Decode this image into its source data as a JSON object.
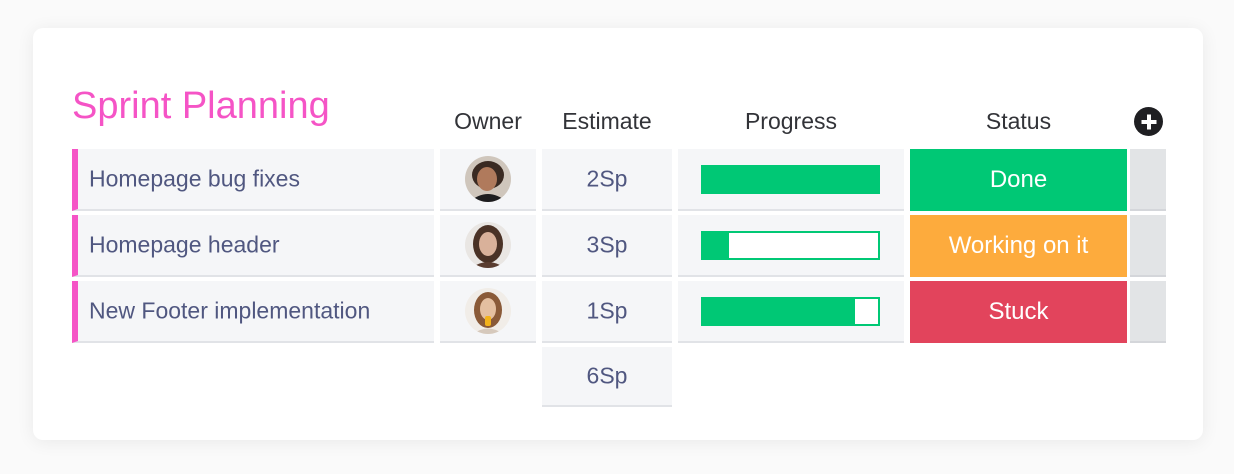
{
  "board": {
    "title": "Sprint Planning",
    "columns": {
      "owner": "Owner",
      "estimate": "Estimate",
      "progress": "Progress",
      "status": "Status"
    }
  },
  "colors": {
    "accent": "#f554c6",
    "done": "#00c875",
    "working": "#fdab3d",
    "stuck": "#e2445c"
  },
  "rows": [
    {
      "name": "Homepage bug fixes",
      "owner_avatar": "person-avatar-1",
      "estimate": "2Sp",
      "progress": 1.0,
      "status": "Done",
      "status_color": "#00c875"
    },
    {
      "name": "Homepage header",
      "owner_avatar": "person-avatar-2",
      "estimate": "3Sp",
      "progress": 0.15,
      "status": "Working on it",
      "status_color": "#fdab3d"
    },
    {
      "name": "New Footer implementation",
      "owner_avatar": "person-avatar-3",
      "estimate": "1Sp",
      "progress": 0.87,
      "status": "Stuck",
      "status_color": "#e2445c"
    }
  ],
  "summary": {
    "estimate_total": "6Sp"
  },
  "icons": {
    "add_column": "plus-circle-icon"
  }
}
